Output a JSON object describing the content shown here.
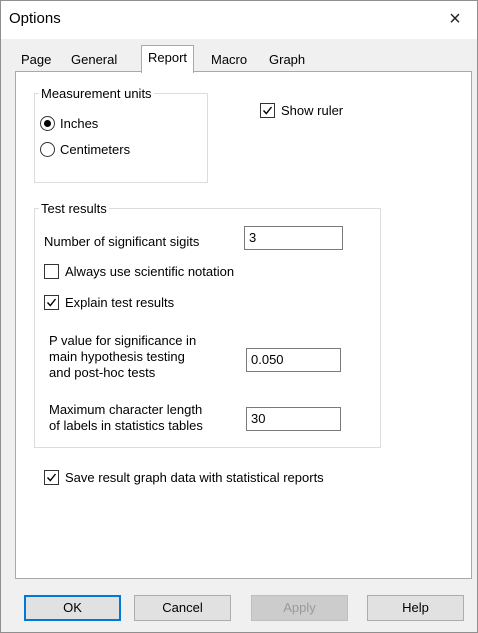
{
  "window": {
    "title": "Options",
    "close_glyph": "×"
  },
  "tabs": [
    {
      "label": "Page",
      "active": false
    },
    {
      "label": "General",
      "active": false
    },
    {
      "label": "Report",
      "active": true
    },
    {
      "label": "Macro",
      "active": false
    },
    {
      "label": "Graph",
      "active": false
    }
  ],
  "measurement": {
    "group_label": "Measurement units",
    "options": [
      {
        "label": "Inches",
        "checked": true
      },
      {
        "label": "Centimeters",
        "checked": false
      }
    ]
  },
  "show_ruler": {
    "label": "Show ruler",
    "checked": true
  },
  "test_results": {
    "group_label": "Test results",
    "sig_digits": {
      "label": "Number of significant sigits",
      "value": "3"
    },
    "scientific": {
      "label": "Always use scientific notation",
      "checked": false
    },
    "explain": {
      "label": "Explain test results",
      "checked": true
    },
    "p_value": {
      "label_lines": [
        "P value for significance in",
        "main hypothesis testing",
        "and post-hoc tests"
      ],
      "value": "0.050"
    },
    "max_len": {
      "label_lines": [
        "Maximum character length",
        "of labels in statistics tables"
      ],
      "value": "30"
    }
  },
  "save_graph": {
    "label": "Save result graph data with statistical reports",
    "checked": true
  },
  "buttons": {
    "ok": "OK",
    "cancel": "Cancel",
    "apply": "Apply",
    "help": "Help"
  },
  "colors": {
    "accent": "#0078d7",
    "disabled_text": "#9a9a9a"
  },
  "icons": {
    "close": "close-icon",
    "check": "check-icon"
  }
}
